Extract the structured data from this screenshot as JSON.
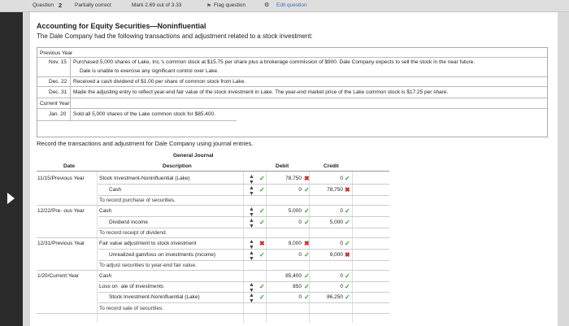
{
  "topbar": {
    "question_label": "Question",
    "question_number": "2",
    "status": "Partially correct",
    "mark": "Mark 2.69 out of 3.33",
    "flag": "Flag question",
    "edit": "Edit question"
  },
  "title": "Accounting for Equity Securities—Noninfluential",
  "intro": "The Dale Company had the following transactions and adjustment related to a stock investment:",
  "facts": {
    "previous_year": "Previous Year",
    "current_year": "Current Year",
    "rows": [
      {
        "date": "Nov. 15",
        "text": "Purchased 5,000 shares of Lake, Inc.'s common stock at $15.75 per share plus a brokerage commission of $900. Dale Company expects to sell the stock in the near future.",
        "text2": "Dale is unable to exercise any significant control over Lake."
      },
      {
        "date": "Dec. 22",
        "text": "Received a cash dividend of $1.00 per share of common stock from Lake."
      },
      {
        "date": "Dec. 31",
        "text": "Made the adjusting entry to reflect year-end fair value of the stock investment in Lake. The year-end market price of the Lake common stock is $17.25 per share."
      },
      {
        "date": "Jan. 20",
        "text": "Sold all 5,000 shares of the Lake common stock for $85,400."
      }
    ]
  },
  "instruction": "Record the transactions and adjustment for Dale Company using journal entries.",
  "journal": {
    "title": "General Journal",
    "col_date": "Date",
    "col_desc": "Description",
    "col_debit": "Debit",
    "col_credit": "Credit",
    "entries": [
      {
        "date": "11/15/Previous Year",
        "line1": "Stock Investment-Noninfluential (Lake)",
        "line2": "Cash",
        "debit1": "78,750",
        "debit2": "0",
        "credit1": "0",
        "credit2": "78,750",
        "memo": "To record purchase of securities."
      },
      {
        "date": "12/22/Pre··ous Year",
        "line1": "Cash",
        "line2": "Dividend income",
        "debit1": "5,000",
        "debit2": "0",
        "credit1": "0",
        "credit2": "5,000",
        "memo": "To record receipt of dividend."
      },
      {
        "date": "12/31/Previous Year",
        "line1": "Fair value adjustment to stock investment",
        "line2": "Unrealized gain/loss on investments (income)",
        "debit1": "9,000",
        "debit2": "0",
        "credit1": "0",
        "credit2": "9,000",
        "memo": "To adjust securities to year-end fair value."
      },
      {
        "date": "1/20/Current Year",
        "line1": "Cash",
        "line2": "Loss on ·ale of investments",
        "line3": "Stock Investment-Noninfluential (Lake)",
        "debit1": "85,400",
        "debit2": "850",
        "debit3": "0",
        "credit1": "0",
        "credit2": "0",
        "credit3": "86,250",
        "memo": "To record sale of securities."
      }
    ]
  },
  "colors": {
    "correct": "#2e9e2e",
    "incorrect": "#d02525",
    "sidebar": "#2b2b2b"
  }
}
